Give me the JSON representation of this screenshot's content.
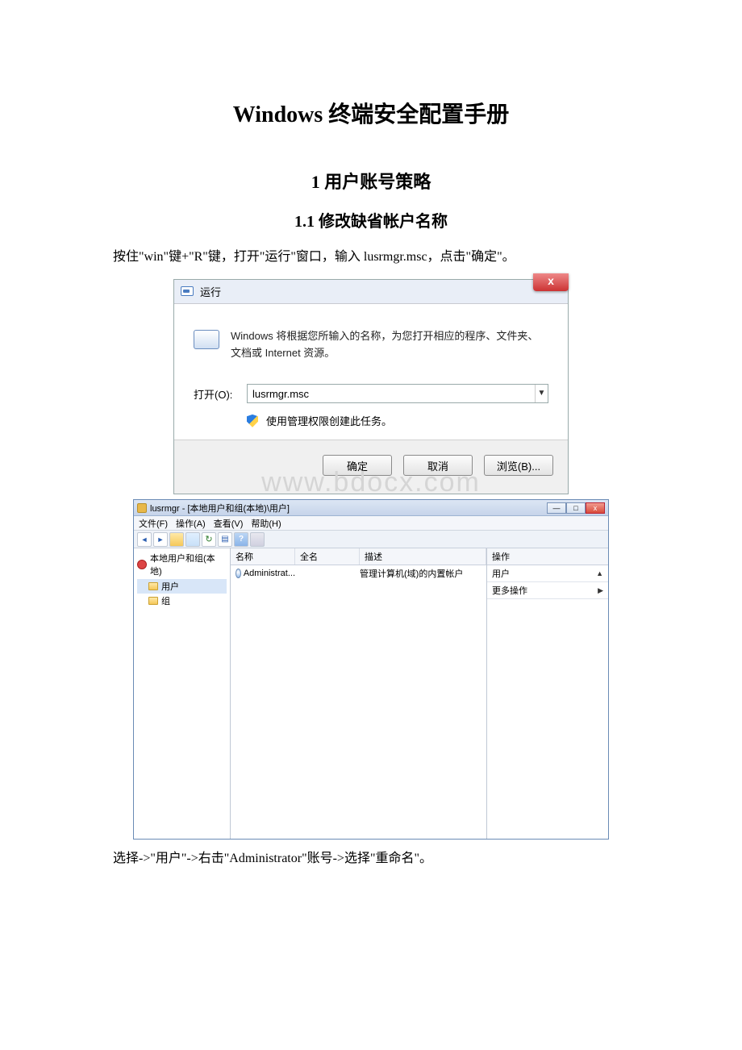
{
  "doc": {
    "title": "Windows 终端安全配置手册",
    "section1": "1 用户账号策略",
    "section11": "1.1 修改缺省帐户名称",
    "para1": "按住\"win\"键+\"R\"键，打开\"运行\"窗口，输入 lusrmgr.msc，点击\"确定\"。",
    "para2": "选择->\"用户\"->右击\"Administrator\"账号->选择\"重命名\"。"
  },
  "watermark": "www.bdocx.com",
  "run": {
    "title": "运行",
    "close": "x",
    "description": "Windows 将根据您所输入的名称，为您打开相应的程序、文件夹、文档或 Internet 资源。",
    "open_label": "打开(O):",
    "input_value": "lusrmgr.msc",
    "shield_text": "使用管理权限创建此任务。",
    "ok": "确定",
    "cancel": "取消",
    "browse": "浏览(B)..."
  },
  "mmc": {
    "title": "lusrmgr - [本地用户和组(本地)\\用户]",
    "menu": {
      "file": "文件(F)",
      "action": "操作(A)",
      "view": "查看(V)",
      "help": "帮助(H)"
    },
    "tree": {
      "root": "本地用户和组(本地)",
      "users": "用户",
      "groups": "组"
    },
    "list": {
      "col_name": "名称",
      "col_fullname": "全名",
      "col_desc": "描述",
      "row1_name": "Administrat...",
      "row1_desc": "管理计算机(域)的内置帐户"
    },
    "actions": {
      "header": "操作",
      "users": "用户",
      "more": "更多操作"
    },
    "winbtns": {
      "min": "—",
      "max": "□",
      "close": "x"
    }
  }
}
